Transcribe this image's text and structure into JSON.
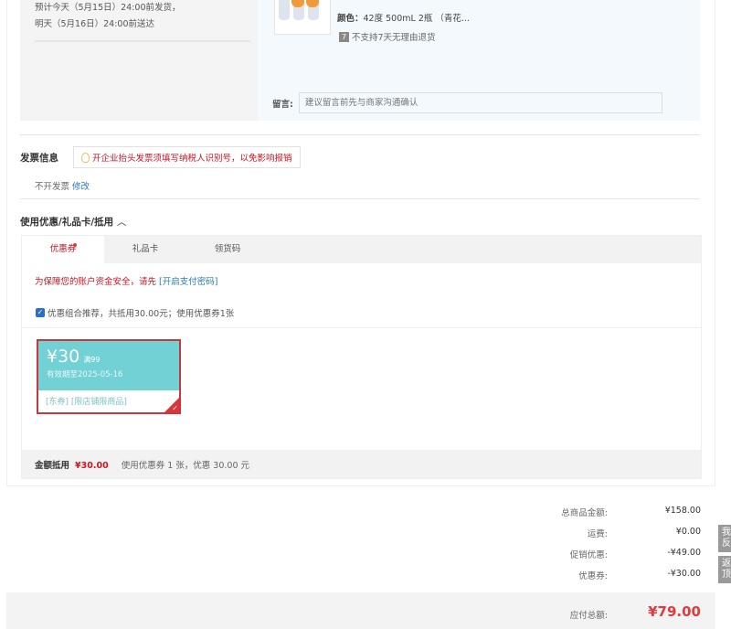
{
  "shipping": {
    "line1": "预计今天（5月15日）24:00前发货，",
    "line2": "明天（5月16日）24:00前送达"
  },
  "goods": {
    "color_label": "颜色：",
    "color_value": "42度 500mL 2瓶 （青花...",
    "return_icon": "7",
    "return_policy": "不支持7天无理由退货",
    "message_label": "留言:",
    "message_placeholder": "建议留言前先与商家沟通确认"
  },
  "invoice": {
    "title": "发票信息",
    "tip": "开企业抬头发票须填写纳税人识别号，以免影响报销",
    "value": "不开发票",
    "edit": "修改"
  },
  "coupons": {
    "title": "使用优惠/礼品卡/抵用",
    "tabs": [
      "优惠券",
      "礼品卡",
      "领货码"
    ],
    "security_text": "为保障您的账户资金安全，请先",
    "security_link": "[开启支付密码]",
    "recommend": "优惠组合推荐，共抵用30.00元；使用优惠券1张",
    "coupon": {
      "amount": "¥30",
      "condition": "满99",
      "expiry": "有效期至2025-05-16",
      "tags": "[东券] [限店铺限商品]"
    },
    "footer_label": "金额抵用",
    "footer_amount": "¥30.00",
    "footer_detail": "使用优惠券 1 张，优惠 30.00 元"
  },
  "summary": {
    "rows": [
      {
        "label": "总商品金额:",
        "value": "¥158.00"
      },
      {
        "label": "运费:",
        "value": "¥0.00"
      },
      {
        "label": "促销优惠:",
        "value": "-¥49.00"
      },
      {
        "label": "优惠券:",
        "value": "-¥30.00"
      }
    ],
    "total_label": "应付总额:",
    "total_value": "¥79.00"
  },
  "side": {
    "feedback": [
      "我",
      "反"
    ],
    "top": [
      "返",
      "顶"
    ]
  }
}
